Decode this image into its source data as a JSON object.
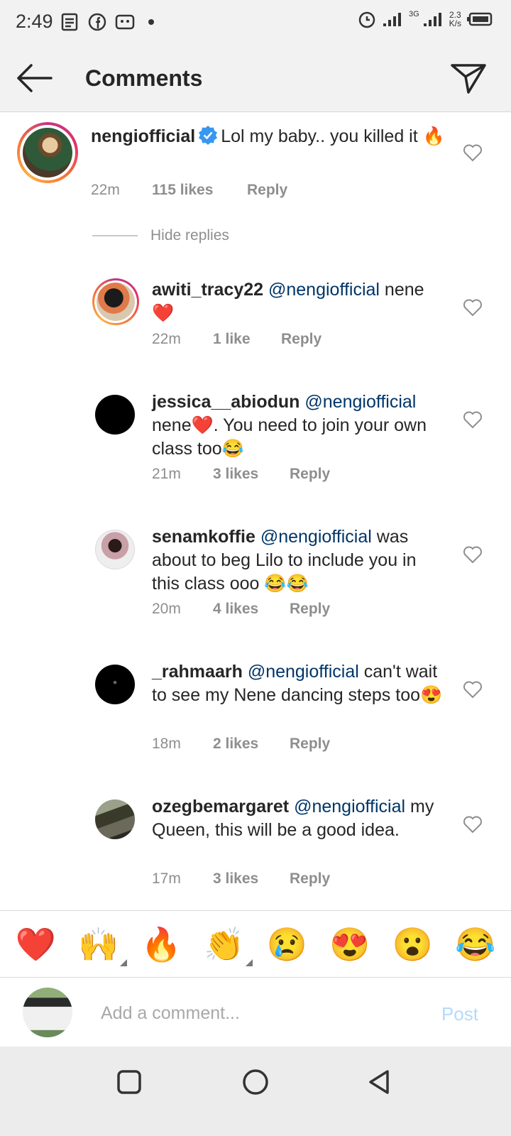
{
  "status_bar": {
    "time": "2:49",
    "network": "3G",
    "speed_value": "2.3",
    "speed_unit": "K/s"
  },
  "header": {
    "title": "Comments",
    "back_icon": "arrow-left-icon",
    "share_icon": "paper-plane-icon"
  },
  "comments": [
    {
      "username": "nengiofficial",
      "verified": true,
      "mention": "",
      "text": "Lol my baby.. you killed it 🔥",
      "time": "22m",
      "likes": "115 likes",
      "reply": "Reply"
    }
  ],
  "hide_replies_label": "Hide replies",
  "replies": [
    {
      "username": "awiti_tracy22",
      "mention": "@nengiofficial",
      "text": "nene❤️",
      "time": "22m",
      "likes": "1 like",
      "reply": "Reply"
    },
    {
      "username": "jessica__abiodun",
      "mention": "@nengiofficial",
      "text": "nene❤️. You need to join your own class too😂",
      "time": "21m",
      "likes": "3 likes",
      "reply": "Reply"
    },
    {
      "username": "senamkoffie",
      "mention": "@nengiofficial",
      "text": "was about to beg Lilo to include you in this class ooo 😂😂",
      "time": "20m",
      "likes": "4 likes",
      "reply": "Reply"
    },
    {
      "username": "_rahmaarh",
      "mention": "@nengiofficial",
      "text": "can't wait to see my Nene dancing steps too😍",
      "time": "18m",
      "likes": "2 likes",
      "reply": "Reply"
    },
    {
      "username": "ozegbemargaret",
      "mention": "@nengiofficial",
      "text": "my Queen, this will be a good idea.",
      "time": "17m",
      "likes": "3 likes",
      "reply": "Reply"
    }
  ],
  "emoji_bar": [
    "❤️",
    "🙌",
    "🔥",
    "👏",
    "😢",
    "😍",
    "😮",
    "😂"
  ],
  "add_comment": {
    "placeholder": "Add a comment...",
    "post_label": "Post"
  }
}
